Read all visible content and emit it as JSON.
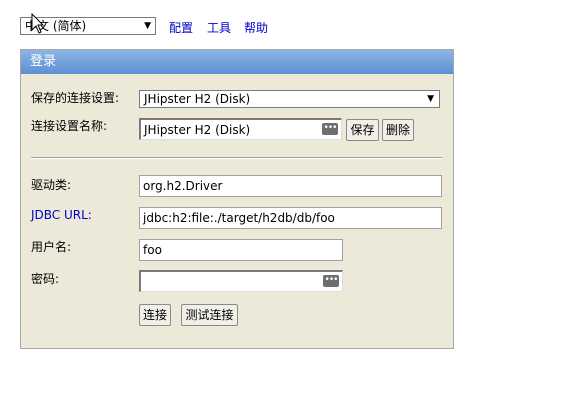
{
  "topbar": {
    "language_value": "中文 (简体)",
    "links": {
      "preferences": "配置",
      "tools": "工具",
      "help": "帮助"
    }
  },
  "login": {
    "title": "登录",
    "saved_settings_label": "保存的连接设置:",
    "saved_settings_value": "JHipster H2 (Disk)",
    "setting_name_label": "连接设置名称:",
    "setting_name_value": "JHipster H2 (Disk)",
    "save_button": "保存",
    "remove_button": "删除",
    "driver_label": "驱动类:",
    "driver_value": "org.h2.Driver",
    "jdbc_label": "JDBC URL:",
    "jdbc_value": "jdbc:h2:file:./target/h2db/db/foo",
    "user_label": "用户名:",
    "user_value": "foo",
    "password_label": "密码:",
    "password_value": "",
    "connect_button": "连接",
    "test_button": "测试连接"
  },
  "icons": {
    "dropdown": "chevron-down-icon",
    "key": "password-manager-icon",
    "cursor": "mouse-pointer-icon"
  }
}
